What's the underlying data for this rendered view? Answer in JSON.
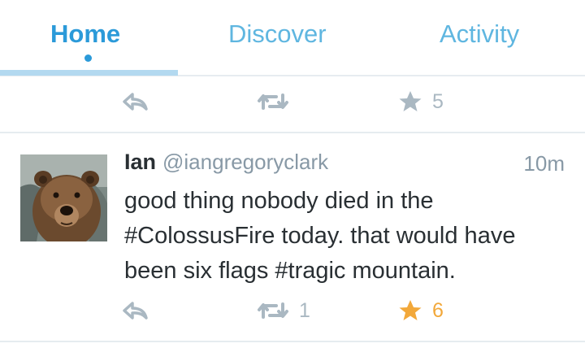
{
  "tabs": [
    {
      "label": "Home",
      "active": true
    },
    {
      "label": "Discover",
      "active": false
    },
    {
      "label": "Activity",
      "active": false
    }
  ],
  "colors": {
    "accent": "#2b9ad9",
    "tab_inactive": "#5fb6e0",
    "icon_gray": "#aab8c2",
    "favorite_active": "#f2a83a",
    "text": "#292f33",
    "muted": "#8899a6"
  },
  "previous_tweet": {
    "actions": {
      "reply_icon": "reply-icon",
      "retweet_icon": "retweet-icon",
      "retweet_count": "",
      "favorite_icon": "star-icon",
      "favorite_count": "5"
    }
  },
  "tweet": {
    "author_name": "Ian",
    "author_handle": "@iangregoryclark",
    "timestamp": "10m",
    "avatar": "bear-avatar",
    "text": "good thing nobody died in the #ColossusFire today. that would have been six flags #tragic mountain.",
    "actions": {
      "reply_icon": "reply-icon",
      "retweet_icon": "retweet-icon",
      "retweet_count": "1",
      "favorite_icon": "star-icon",
      "favorite_count": "6",
      "favorited": true
    }
  }
}
